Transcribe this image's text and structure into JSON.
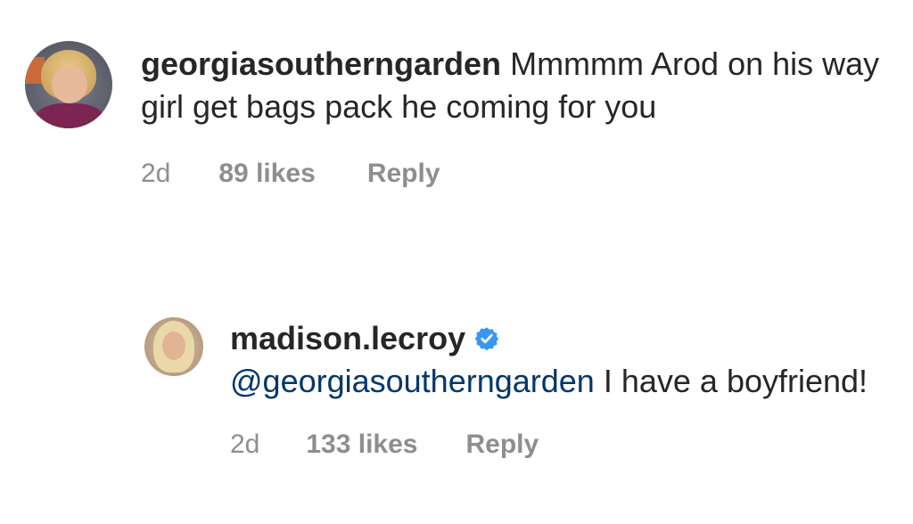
{
  "comments": [
    {
      "username": "georgiasoutherngarden",
      "text": "Mmmmm Arod on his way girl get bags pack he coming for you",
      "time": "2d",
      "likes": "89 likes",
      "reply_label": "Reply"
    },
    {
      "username": "madison.lecroy",
      "verified": true,
      "mention": "@georgiasoutherngarden",
      "text": "I have a boyfriend!",
      "time": "2d",
      "likes": "133 likes",
      "reply_label": "Reply"
    }
  ],
  "colors": {
    "text": "#262626",
    "meta": "#8e8e8e",
    "mention": "#00376b",
    "verified": "#3897f0"
  },
  "icons": {
    "verified": "verified-badge-icon"
  }
}
